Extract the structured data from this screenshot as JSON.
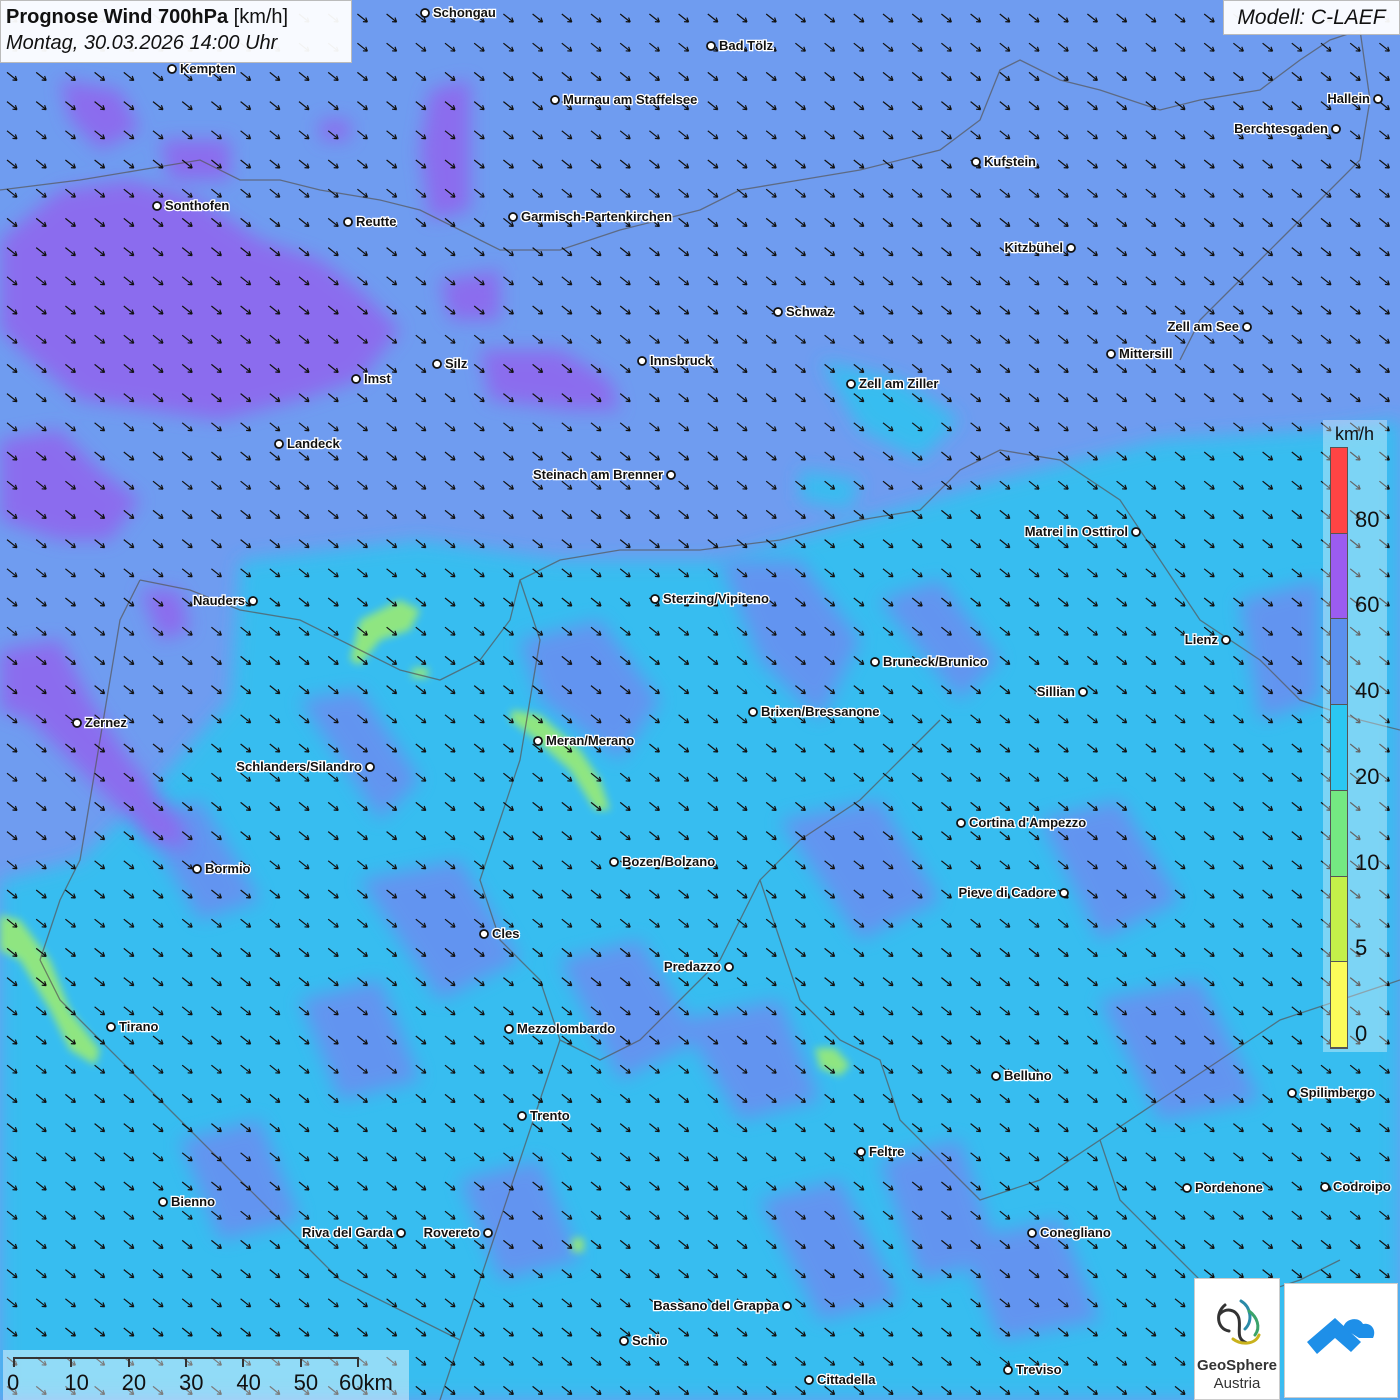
{
  "header": {
    "title_bold": "Prognose Wind 700hPa",
    "title_unit": " [km/h]",
    "subtitle": "Montag, 30.03.2026 14:00 Uhr"
  },
  "model_label": "Modell: C-LAEF",
  "legend": {
    "unit": "km/h",
    "colors": [
      "#ff4444",
      "#9b5cf0",
      "#5b90ee",
      "#2bc7f2",
      "#74e882",
      "#c4f04a",
      "#fbfb5a"
    ],
    "ticks": [
      "80",
      "60",
      "40",
      "20",
      "10",
      "5",
      "0"
    ]
  },
  "scalebar": {
    "labels": [
      "0",
      "10",
      "20",
      "30",
      "40",
      "50",
      "60km"
    ]
  },
  "logos": {
    "geosphere_line1": "GeoSphere",
    "geosphere_line2": "Austria"
  },
  "colors": {
    "background": "#6f9cf0",
    "cyan_zone": "#36bff0",
    "purple_zone": "#8d6bee",
    "green_zone": "#94e87c",
    "arrows": "#111111"
  },
  "wind_direction_icon": "arrow-southeast",
  "cities": [
    {
      "name": "Schongau"
    },
    {
      "name": "Bad Tölz"
    },
    {
      "name": "Kempten"
    },
    {
      "name": "Murnau am Staffelsee"
    },
    {
      "name": "Hallein"
    },
    {
      "name": "Berchtesgaden"
    },
    {
      "name": "Kufstein"
    },
    {
      "name": "Sonthofen"
    },
    {
      "name": "Reutte"
    },
    {
      "name": "Garmisch-Partenkirchen"
    },
    {
      "name": "Kitzbühel"
    },
    {
      "name": "Schwaz"
    },
    {
      "name": "Zell am See"
    },
    {
      "name": "Mittersill"
    },
    {
      "name": "Silz"
    },
    {
      "name": "Innsbruck"
    },
    {
      "name": "Imst"
    },
    {
      "name": "Zell am Ziller"
    },
    {
      "name": "Landeck"
    },
    {
      "name": "Steinach am Brenner"
    },
    {
      "name": "Matrei in Osttirol"
    },
    {
      "name": "Nauders"
    },
    {
      "name": "Sterzing/Vipiteno"
    },
    {
      "name": "Lienz"
    },
    {
      "name": "Bruneck/Brunico"
    },
    {
      "name": "Sillian"
    },
    {
      "name": "Zernez"
    },
    {
      "name": "Brixen/Bressanone"
    },
    {
      "name": "Meran/Merano"
    },
    {
      "name": "Schlanders/Silandro"
    },
    {
      "name": "Cortina d'Ampezzo"
    },
    {
      "name": "Bozen/Bolzano"
    },
    {
      "name": "Bormio"
    },
    {
      "name": "Pieve di Cadore"
    },
    {
      "name": "Cles"
    },
    {
      "name": "Predazzo"
    },
    {
      "name": "Tirano"
    },
    {
      "name": "Mezzolombardo"
    },
    {
      "name": "Belluno"
    },
    {
      "name": "Spilimbergo"
    },
    {
      "name": "Trento"
    },
    {
      "name": "Feltre"
    },
    {
      "name": "Bienno"
    },
    {
      "name": "Pordenone"
    },
    {
      "name": "Codroipo"
    },
    {
      "name": "Riva del Garda"
    },
    {
      "name": "Rovereto"
    },
    {
      "name": "Conegliano"
    },
    {
      "name": "Bassano del Grappa"
    },
    {
      "name": "Schio"
    },
    {
      "name": "Treviso"
    },
    {
      "name": "Cittadella"
    }
  ]
}
